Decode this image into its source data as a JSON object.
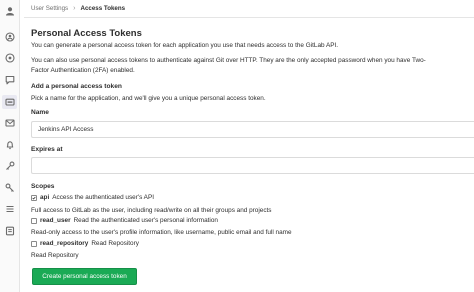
{
  "breadcrumb": {
    "parent": "User Settings",
    "separator": "›",
    "current": "Access Tokens"
  },
  "page": {
    "title": "Personal Access Tokens",
    "intro_1": "You can generate a personal access token for each application you use that needs access to the GitLab API.",
    "intro_2a": "You can also use personal access tokens to authenticate against Git over HTTP. They are the only accepted password when you have Two-",
    "intro_2b": "Factor Authentication (2FA) enabled.",
    "add_heading": "Add a personal access token",
    "add_help": "Pick a name for the application, and we'll give you a unique personal access token."
  },
  "form": {
    "name_label": "Name",
    "name_value": "Jenkins API Access",
    "expires_label": "Expires at",
    "expires_value": "",
    "scopes_label": "Scopes",
    "scopes": [
      {
        "name": "api",
        "desc": "Access the authenticated user's API",
        "checked": true,
        "detail": "Full access to GitLab as the user, including read/write on all their groups and projects"
      },
      {
        "name": "read_user",
        "desc": "Read the authenticated user's personal information",
        "checked": false,
        "detail": "Read-only access to the user's profile information, like username, public email and full name"
      },
      {
        "name": "read_repository",
        "desc": "Read Repository",
        "checked": false,
        "detail": "Read Repository"
      }
    ],
    "submit_label": "Create personal access token"
  },
  "colors": {
    "primary_button": "#1aaa55",
    "text": "#2e2e2e",
    "muted": "#707070",
    "border": "#dbdbdb"
  },
  "sidebar_icons": [
    "avatar-icon",
    "profile-icon",
    "account-icon",
    "comment-icon",
    "access-tokens-icon",
    "email-icon",
    "notifications-icon",
    "ssh-key-icon",
    "gpg-key-icon",
    "preferences-icon",
    "active-sessions-icon"
  ]
}
